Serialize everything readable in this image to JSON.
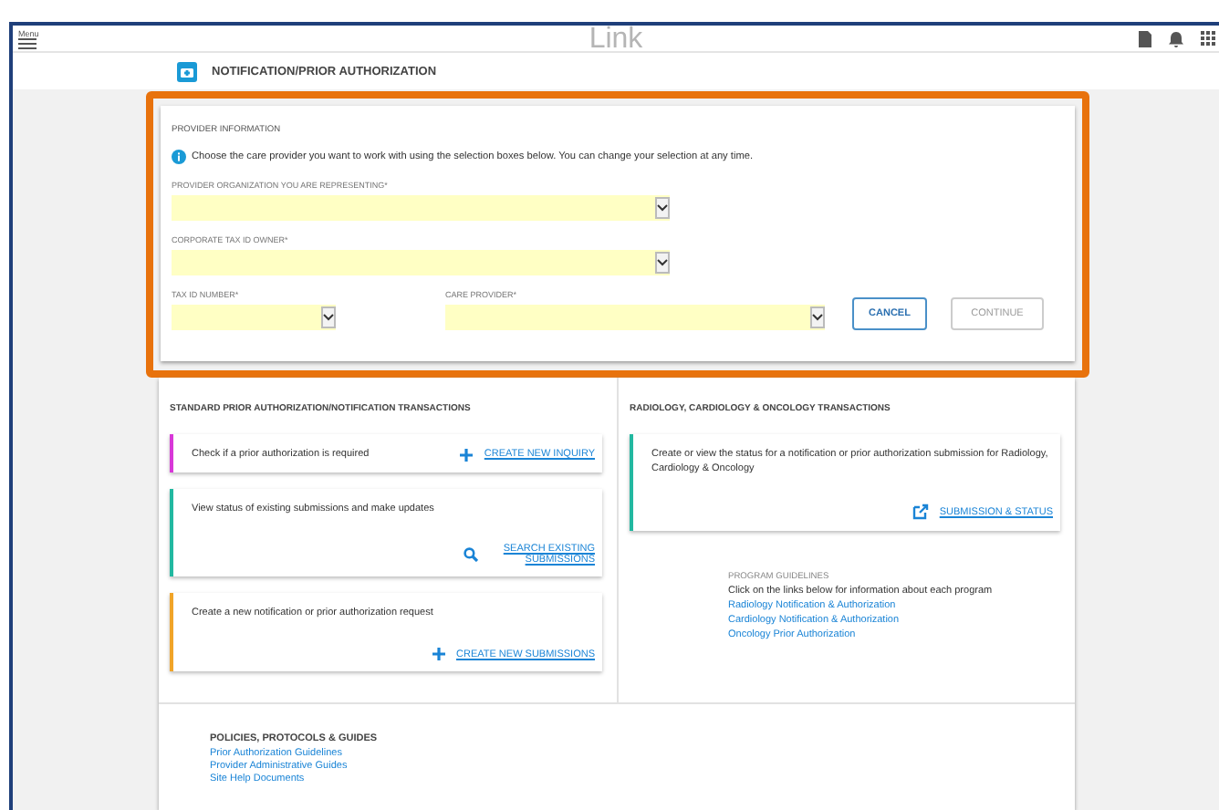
{
  "header": {
    "menu_label": "Menu",
    "logo": "Link"
  },
  "page_title": "NOTIFICATION/PRIOR AUTHORIZATION",
  "provider_information": {
    "heading": "PROVIDER INFORMATION",
    "info": "Choose the care provider you want to work with using the selection boxes below. You can change your selection at any time.",
    "fields": [
      {
        "kind": "wide",
        "label": "PROVIDER ORGANIZATION YOU ARE REPRESENTING*"
      },
      {
        "kind": "wide",
        "label": "CORPORATE TAX ID OWNER*"
      },
      {
        "kind": "small",
        "label": "TAX ID NUMBER*"
      },
      {
        "kind": "medium",
        "label": "CARE PROVIDER*"
      }
    ],
    "buttons": [
      {
        "label": "CANCEL",
        "disabled": false
      },
      {
        "label": "CONTINUE",
        "disabled": true
      }
    ]
  },
  "standard": {
    "heading": "STANDARD PRIOR AUTHORIZATION/NOTIFICATION TRANSACTIONS",
    "cards": [
      {
        "kind": "inquiry",
        "text": "Check if a prior authorization is required",
        "action": "CREATE NEW INQUIRY",
        "color": "#d838d8"
      },
      {
        "kind": "search",
        "text": "View status of existing submissions and make updates",
        "action": "SEARCH EXISTING SUBMISSIONS",
        "color": "#22b8a0"
      },
      {
        "kind": "create",
        "text": "Create a new notification or prior authorization request",
        "action": "CREATE NEW SUBMISSIONS",
        "color": "#f0a428"
      }
    ]
  },
  "specialty": {
    "heading": "RADIOLOGY, CARDIOLOGY & ONCOLOGY TRANSACTIONS",
    "card": {
      "text": "Create or view the status for a notification or prior authorization submission for Radiology, Cardiology & Oncology",
      "action": "SUBMISSION & STATUS",
      "color": "#22b8a0"
    },
    "guidelines": {
      "heading": "PROGRAM GUIDELINES",
      "text": "Click on the links below for information about each program",
      "links": [
        "Radiology Notification & Authorization",
        "Cardiology Notification & Authorization",
        "Oncology Prior Authorization"
      ]
    }
  },
  "policies": {
    "heading": "POLICIES, PROTOCOLS & GUIDES",
    "links": [
      "Prior Authorization Guidelines",
      "Provider Administrative Guides",
      "Site Help Documents"
    ]
  }
}
